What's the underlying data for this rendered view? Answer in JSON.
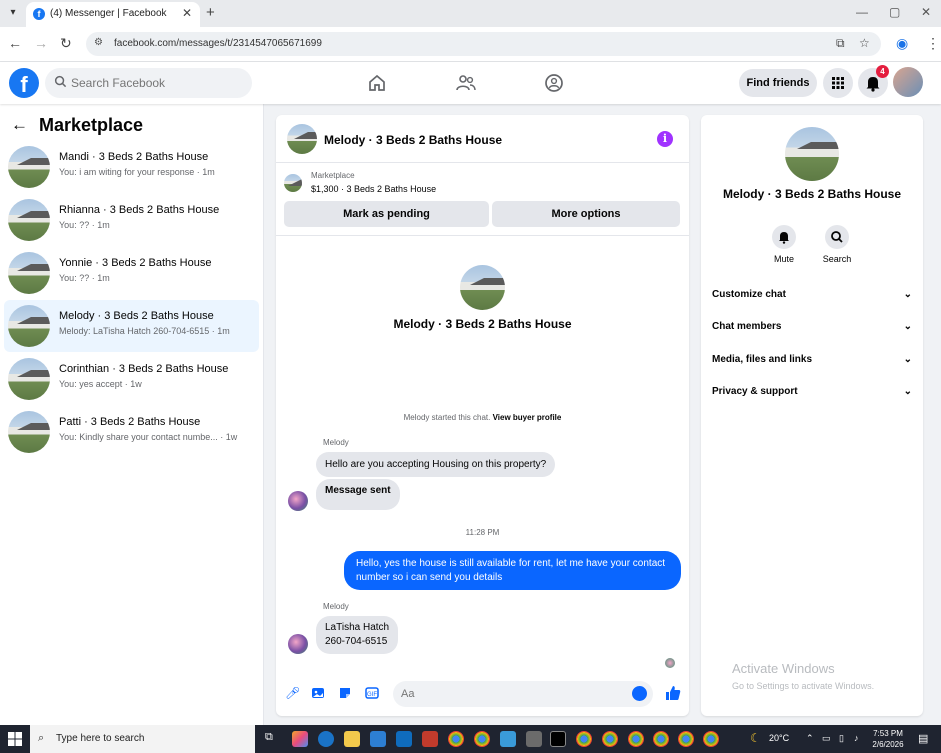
{
  "browser": {
    "tab_title": "(4) Messenger | Facebook",
    "url": "facebook.com/messages/t/2314547065671699",
    "new_tab": "+",
    "tab_close": "✕"
  },
  "fb_header": {
    "search_placeholder": "Search Facebook",
    "find_friends": "Find friends",
    "notification_count": "4",
    "logo": "f"
  },
  "left_panel": {
    "title": "Marketplace",
    "conversations": [
      {
        "name": "Mandi · 3 Beds 2 Baths House",
        "snippet": "You: i am witing for your response · 1m"
      },
      {
        "name": "Rhianna · 3 Beds 2 Baths House",
        "snippet": "You: ?? · 1m"
      },
      {
        "name": "Yonnie · 3 Beds 2 Baths House",
        "snippet": "You: ?? · 1m"
      },
      {
        "name": "Melody · 3 Beds 2 Baths House",
        "snippet": "Melody: LaTisha Hatch 260-704-6515 · 1m"
      },
      {
        "name": "Corinthian · 3 Beds 2 Baths House",
        "snippet": "You: yes accept · 1w"
      },
      {
        "name": "Patti · 3 Beds 2 Baths House",
        "snippet": "You: Kindly share your contact numbe... · 1w"
      }
    ]
  },
  "chat": {
    "header_name": "Melody · 3 Beds 2 Baths House",
    "marketplace_label": "Marketplace",
    "listing": "$1,300 · 3 Beds 2 Baths House",
    "mark_pending": "Mark as pending",
    "more_options": "More options",
    "profile_name": "Melody · 3 Beds 2 Baths House",
    "started_text": "Melody started this chat.",
    "view_buyer": "View buyer profile",
    "sender1": "Melody",
    "msg1": "Hello are you accepting Housing on this property?",
    "msg2": "Message sent",
    "timestamp": "11:28 PM",
    "msg_out": "Hello, yes the house is still available for rent, let me have your contact number so i can send you  details",
    "sender2": "Melody",
    "msg3_line1": "LaTisha Hatch",
    "msg3_line2": "260-704-6515",
    "composer_placeholder": "Aa"
  },
  "right_panel": {
    "name": "Melody · 3 Beds 2 Baths House",
    "mute": "Mute",
    "search": "Search",
    "sections": [
      "Customize chat",
      "Chat members",
      "Media, files and links",
      "Privacy & support"
    ],
    "watermark_title": "Activate Windows",
    "watermark_sub": "Go to Settings to activate Windows."
  },
  "taskbar": {
    "search_placeholder": "Type here to search",
    "weather": "20°C",
    "time": "7:53 PM",
    "date": "2/6/2026"
  },
  "colors": {
    "fb_blue": "#1877f2",
    "messenger_blue": "#0a66ff",
    "active_row": "#ebf5ff",
    "info_purple": "#a033ff",
    "badge_red": "#e41e3f"
  }
}
